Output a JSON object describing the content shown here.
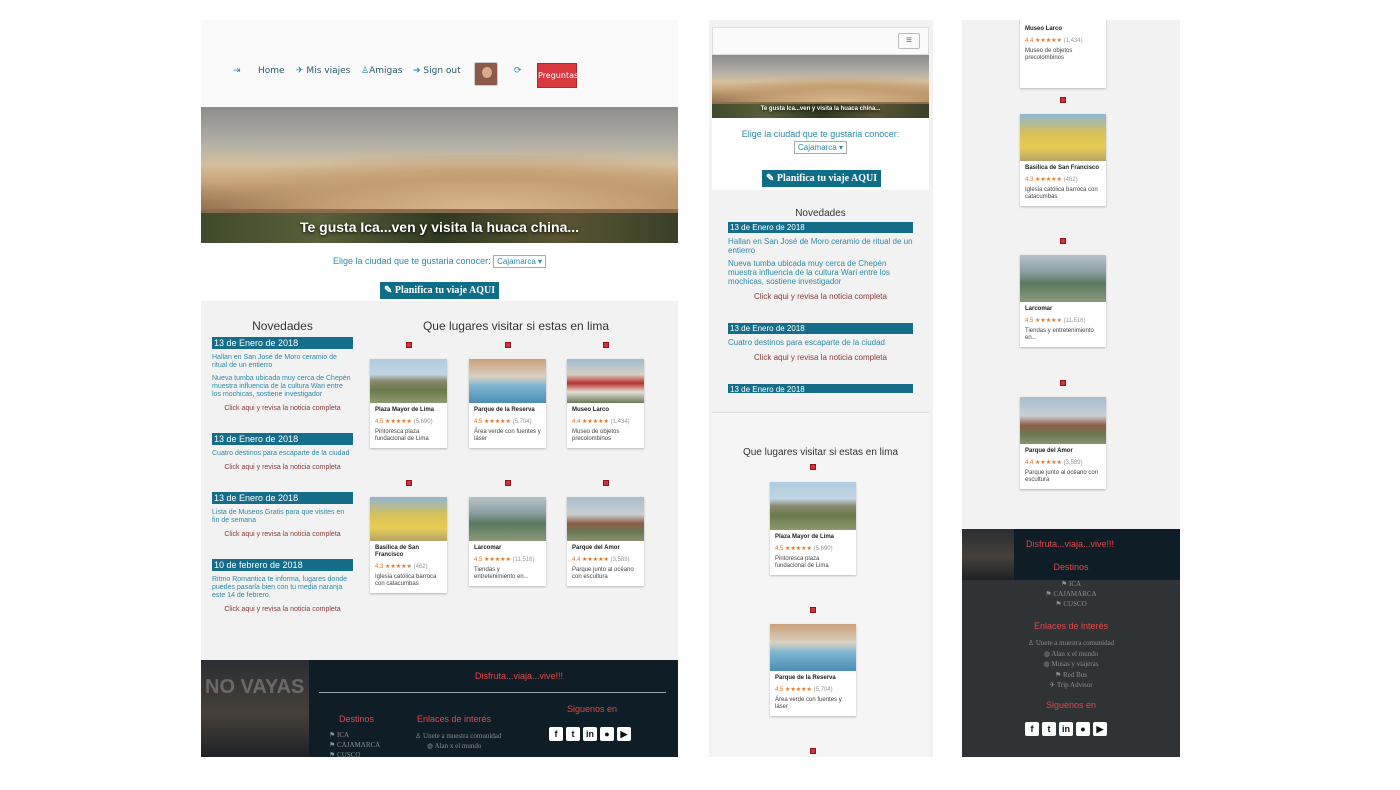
{
  "nav": {
    "home": "Home",
    "viajes": "Mis viajes",
    "amigas": "Amigas",
    "signout": "Sign out",
    "button": "Preguntas"
  },
  "hero": {
    "caption": "Te gusta Ica...ven y visita la huaca china..."
  },
  "city": {
    "label": "Elige la ciudad que te gustaria conocer:",
    "selected": "Cajamarca"
  },
  "plan": {
    "label": "Planifica tu viaje AQUI",
    "icon": "pencil-icon"
  },
  "novedades": {
    "title": "Novedades",
    "click": "Click aqui y revisa la noticia completa",
    "items": [
      {
        "date": "13 de Enero de 2018",
        "links": [
          "Hallan en San José de Moro ceramio de ritual de un entierro",
          "Nueva tumba ubicada muy cerca de Chepén muestra influencia de la cultura Wari entre los mochicas, sostiene investigador"
        ]
      },
      {
        "date": "13 de Enero de 2018",
        "links": [
          "Cuatro destinos para escaparte de la ciudad"
        ]
      },
      {
        "date": "13 de Enero de 2018",
        "links": [
          "Lista de Museos Gratis para que visites en fin de semana"
        ]
      },
      {
        "date": "10 de febrero de 2018",
        "links": [
          "Ritmo Romantica te informa, lugares donde puedes pasarla bien con tu media naranja este 14 de febrero."
        ]
      }
    ]
  },
  "places": {
    "title": "Que lugares visitar si estas en lima",
    "items": [
      {
        "name": "Plaza Mayor de Lima",
        "rating": "4.5",
        "stars": "★★★★★",
        "count": "(5,690)",
        "desc": "Pintoresca plaza fundacional de Lima"
      },
      {
        "name": "Parque de la Reserva",
        "rating": "4.5",
        "stars": "★★★★★",
        "count": "(5,704)",
        "desc": "Área verde con fuentes y láser"
      },
      {
        "name": "Museo Larco",
        "rating": "4.4",
        "stars": "★★★★★",
        "count": "(1,434)",
        "desc": "Museo de objetos precolombinos"
      },
      {
        "name": "Basilica de San Francisco",
        "rating": "4.3",
        "stars": "★★★★★",
        "count": "(462)",
        "desc": "Iglesia católica barroca con catacumbas"
      },
      {
        "name": "Larcomar",
        "rating": "4.5",
        "stars": "★★★★★",
        "count": "(11,516)",
        "desc": "Tiendas y entretenimiento en..."
      },
      {
        "name": "Parque del Amor",
        "rating": "4.4",
        "stars": "★★★★★",
        "count": "(3,589)",
        "desc": "Parque junto al océano con escultura"
      }
    ]
  },
  "footer": {
    "brand": "Disfruta...viaja...vive!!!",
    "destinos_title": "Destinos",
    "destinos": [
      "ICA",
      "CAJAMARCA",
      "CUSCO"
    ],
    "enlaces_title": "Enlaces de interés",
    "enlaces": [
      "Unete a muestra comunidad",
      "Alan x el mundo",
      "Musas y viajeras",
      "Red Bus",
      "Trip Advisor"
    ],
    "siguenos": "Siguenos en",
    "social": [
      "f",
      "t",
      "in",
      "",
      "▶"
    ],
    "bgtext": "NO VAYAS"
  },
  "colors": {
    "accent": "#156d8a",
    "red": "#d9393e",
    "footer": "#0f1e26"
  }
}
